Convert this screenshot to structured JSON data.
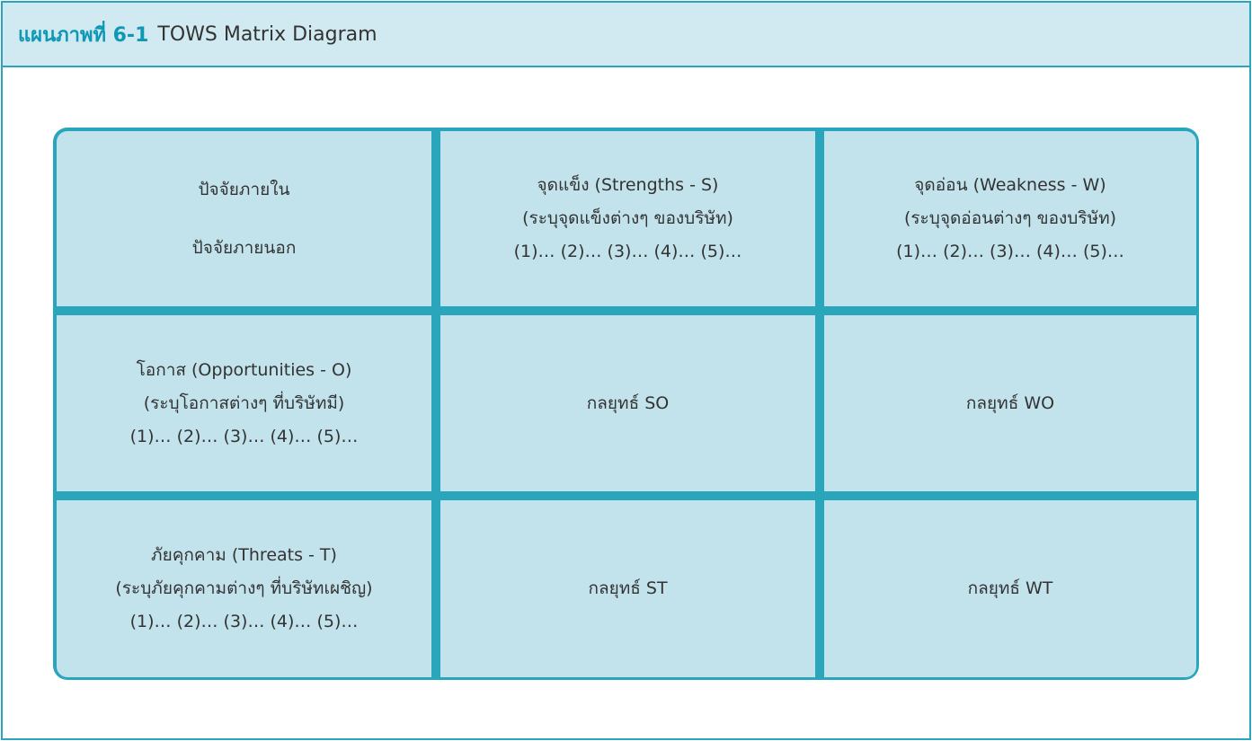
{
  "header": {
    "label": "แผนภาพที่ 6-1",
    "title": "TOWS Matrix Diagram"
  },
  "matrix": {
    "corner": {
      "internal": "ปัจจัยภายใน",
      "external": "ปัจจัยภายนอก"
    },
    "strengths": {
      "title": "จุดแข็ง (Strengths - S)",
      "desc": "(ระบุจุดแข็งต่างๆ ของบริษัท)",
      "items": "(1)… (2)… (3)… (4)… (5)…"
    },
    "weakness": {
      "title": "จุดอ่อน (Weakness - W)",
      "desc": "(ระบุจุดอ่อนต่างๆ ของบริษัท)",
      "items": "(1)… (2)… (3)… (4)… (5)…"
    },
    "opportunities": {
      "title": "โอกาส (Opportunities - O)",
      "desc": "(ระบุโอกาสต่างๆ ที่บริษัทมี)",
      "items": "(1)… (2)… (3)… (4)… (5)…"
    },
    "threats": {
      "title": "ภัยคุกคาม (Threats - T)",
      "desc": "(ระบุภัยคุกคามต่างๆ ที่บริษัทเผชิญ)",
      "items": "(1)… (2)… (3)… (4)… (5)…"
    },
    "strategies": {
      "so": "กลยุทธ์ SO",
      "wo": "กลยุทธ์ WO",
      "st": "กลยุทธ์ ST",
      "wt": "กลยุทธ์ WT"
    }
  },
  "colors": {
    "border": "#2aa6bc",
    "header_bg": "#d1e9f1",
    "cell_bg": "#c2e3ec",
    "label": "#0e98b4"
  }
}
